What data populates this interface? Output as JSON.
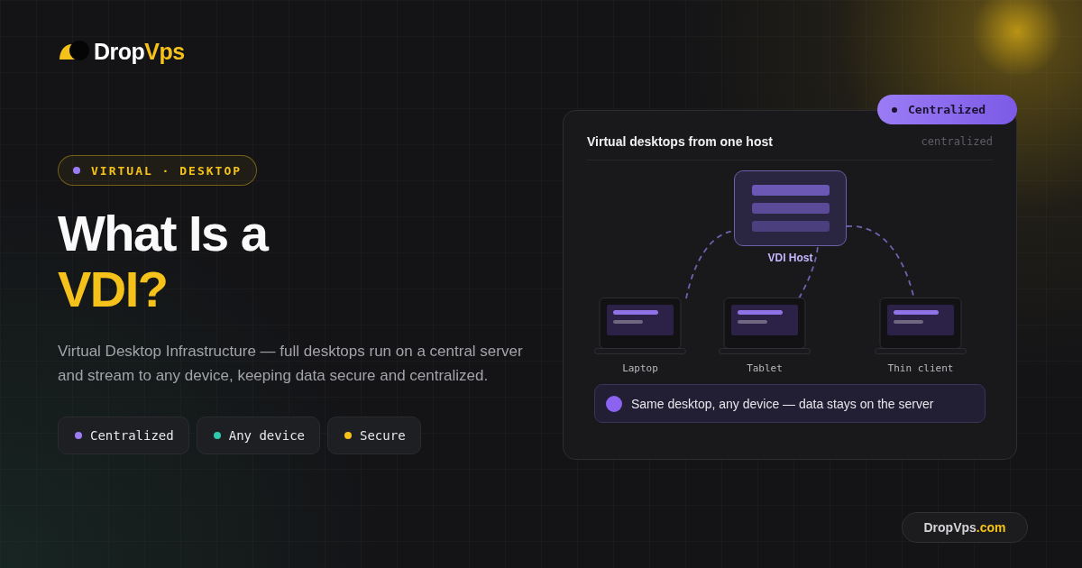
{
  "brand": {
    "name": "Drop",
    "accent": "Vps"
  },
  "tag": {
    "label": "VIRTUAL · DESKTOP"
  },
  "headline": {
    "line_1": "What Is a",
    "line_2": "VDI?"
  },
  "description": "Virtual Desktop Infrastructure — full desktops run on a central server and stream to any device, keeping data secure and centralized.",
  "chips": [
    {
      "label": "Centralized",
      "color": "#9b7cf5"
    },
    {
      "label": "Any device",
      "color": "#2ec9ae"
    },
    {
      "label": "Secure",
      "color": "#f5c21b"
    }
  ],
  "card": {
    "badge": "Centralized",
    "title": "Virtual desktops from one host",
    "caption": "centralized",
    "host": {
      "label": "VDI Host"
    },
    "devices": [
      {
        "label": "Laptop"
      },
      {
        "label": "Tablet"
      },
      {
        "label": "Thin client"
      }
    ],
    "note": "Same desktop, any device — data stays on the server"
  },
  "footer": {
    "site": "DropVps",
    "accent": ".com"
  }
}
